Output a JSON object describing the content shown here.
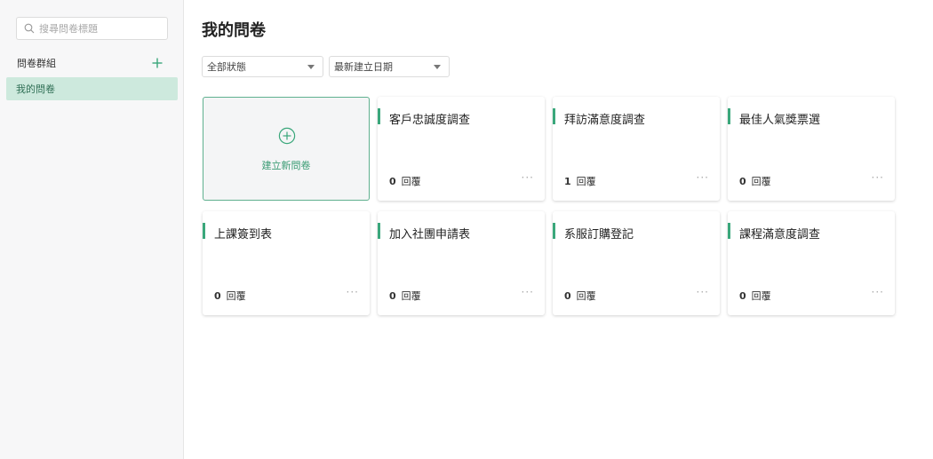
{
  "sidebar": {
    "search_placeholder": "搜尋問卷標題",
    "group_title": "問卷群組",
    "groups": [
      {
        "label": "我的問卷",
        "selected": true
      }
    ]
  },
  "main": {
    "title": "我的問卷",
    "filters": {
      "status": "全部狀態",
      "sort": "最新建立日期"
    },
    "new_survey_label": "建立新問卷",
    "reply_unit": "回覆",
    "more_label": "···",
    "surveys": [
      {
        "title": "客戶忠誠度調查",
        "replies": "0"
      },
      {
        "title": "拜訪滿意度調查",
        "replies": "1"
      },
      {
        "title": "最佳人氣獎票選",
        "replies": "0"
      },
      {
        "title": "上課簽到表",
        "replies": "0"
      },
      {
        "title": "加入社團申請表",
        "replies": "0"
      },
      {
        "title": "系服訂購登記",
        "replies": "0"
      },
      {
        "title": "課程滿意度調查",
        "replies": "0"
      }
    ]
  },
  "colors": {
    "accent": "#3aa77b",
    "selected_bg": "#cde9dd",
    "sidebar_bg": "#f7f7f8"
  }
}
